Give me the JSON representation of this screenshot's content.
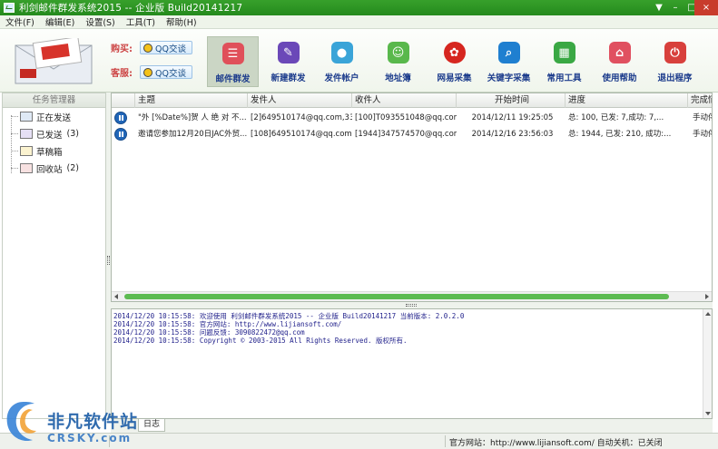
{
  "window": {
    "title": "利剑邮件群发系统2015 -- 企业版   Build20141217",
    "controls": [
      "▼",
      "–",
      "□",
      "×"
    ]
  },
  "menu": [
    {
      "label": "文件(F)"
    },
    {
      "label": "编辑(E)"
    },
    {
      "label": "设置(S)"
    },
    {
      "label": "工具(T)"
    },
    {
      "label": "帮助(H)"
    }
  ],
  "contacts": {
    "buy_label": "购买:",
    "buy_button": "QQ交谈",
    "service_label": "客服:",
    "service_button": "QQ交谈"
  },
  "toolbar": [
    {
      "label": "邮件群发",
      "icon": "mail-list-icon",
      "color": "#e0505a",
      "active": true
    },
    {
      "label": "新建群发",
      "icon": "new-send-icon",
      "color": "#6b48b8"
    },
    {
      "label": "发件帐户",
      "icon": "account-icon",
      "color": "#3aa4d8"
    },
    {
      "label": "地址簿",
      "icon": "address-book-icon",
      "color": "#59b84c"
    },
    {
      "label": "网易采集",
      "icon": "netease-collect-icon",
      "color": "#d6261f"
    },
    {
      "label": "关键字采集",
      "icon": "keyword-search-icon",
      "color": "#1f7fd0"
    },
    {
      "label": "常用工具",
      "icon": "toolbox-icon",
      "color": "#3aa844"
    },
    {
      "label": "使用帮助",
      "icon": "home-help-icon",
      "color": "#e05060"
    },
    {
      "label": "退出程序",
      "icon": "power-icon",
      "color": "#d8403c"
    }
  ],
  "task_manager": {
    "title": "任务管理器",
    "items": [
      {
        "label": "正在发送",
        "count": "",
        "icon": "sending-icon"
      },
      {
        "label": "已发送",
        "count": "(3)",
        "icon": "sent-icon"
      },
      {
        "label": "草稿箱",
        "count": "",
        "icon": "draft-icon"
      },
      {
        "label": "回收站",
        "count": "(2)",
        "icon": "recycle-icon"
      }
    ]
  },
  "table": {
    "columns": [
      "主题",
      "发件人",
      "收件人",
      "开始时间",
      "进度",
      "完成情"
    ],
    "rows": [
      {
        "subject": "\"外 [%Date%]贺 人 绝 对 不...",
        "sender": "[2]649510174@qq.com,3339...",
        "recipient": "[100]T093551048@qq.com,38...",
        "start": "2014/12/11 19:25:05",
        "progress": "总: 100, 已发: 7,成功: 7,...",
        "status": "手动停"
      },
      {
        "subject": "邀请您参加12月20日JAC外贸...",
        "sender": "[108]649510174@qq.com,12...",
        "recipient": "[1944]347574570@qq.com,6...",
        "start": "2014/12/16 23:56:03",
        "progress": "总: 1944, 已发: 210, 成功:...",
        "status": "手动停"
      }
    ]
  },
  "log": {
    "lines": [
      "2014/12/20 10:15:58: 欢迎使用 利剑邮件群发系统2015 -- 企业版   Build20141217  当前版本: 2.0.2.0",
      "2014/12/20 10:15:58: 官方网站: http://www.lijiansoft.com/",
      "2014/12/20 10:15:58: 问题反馈: 3090822472@qq.com",
      "2014/12/20 10:15:58: Copyright © 2003-2015  All Rights Reserved. 版权所有."
    ],
    "tab_label": "日志"
  },
  "statusbar": {
    "text": "官方网站：http://www.lijiansoft.com/  自动关机：已关闭"
  },
  "watermark": {
    "text": "非凡软件站",
    "sub": "CRSKY.com"
  }
}
